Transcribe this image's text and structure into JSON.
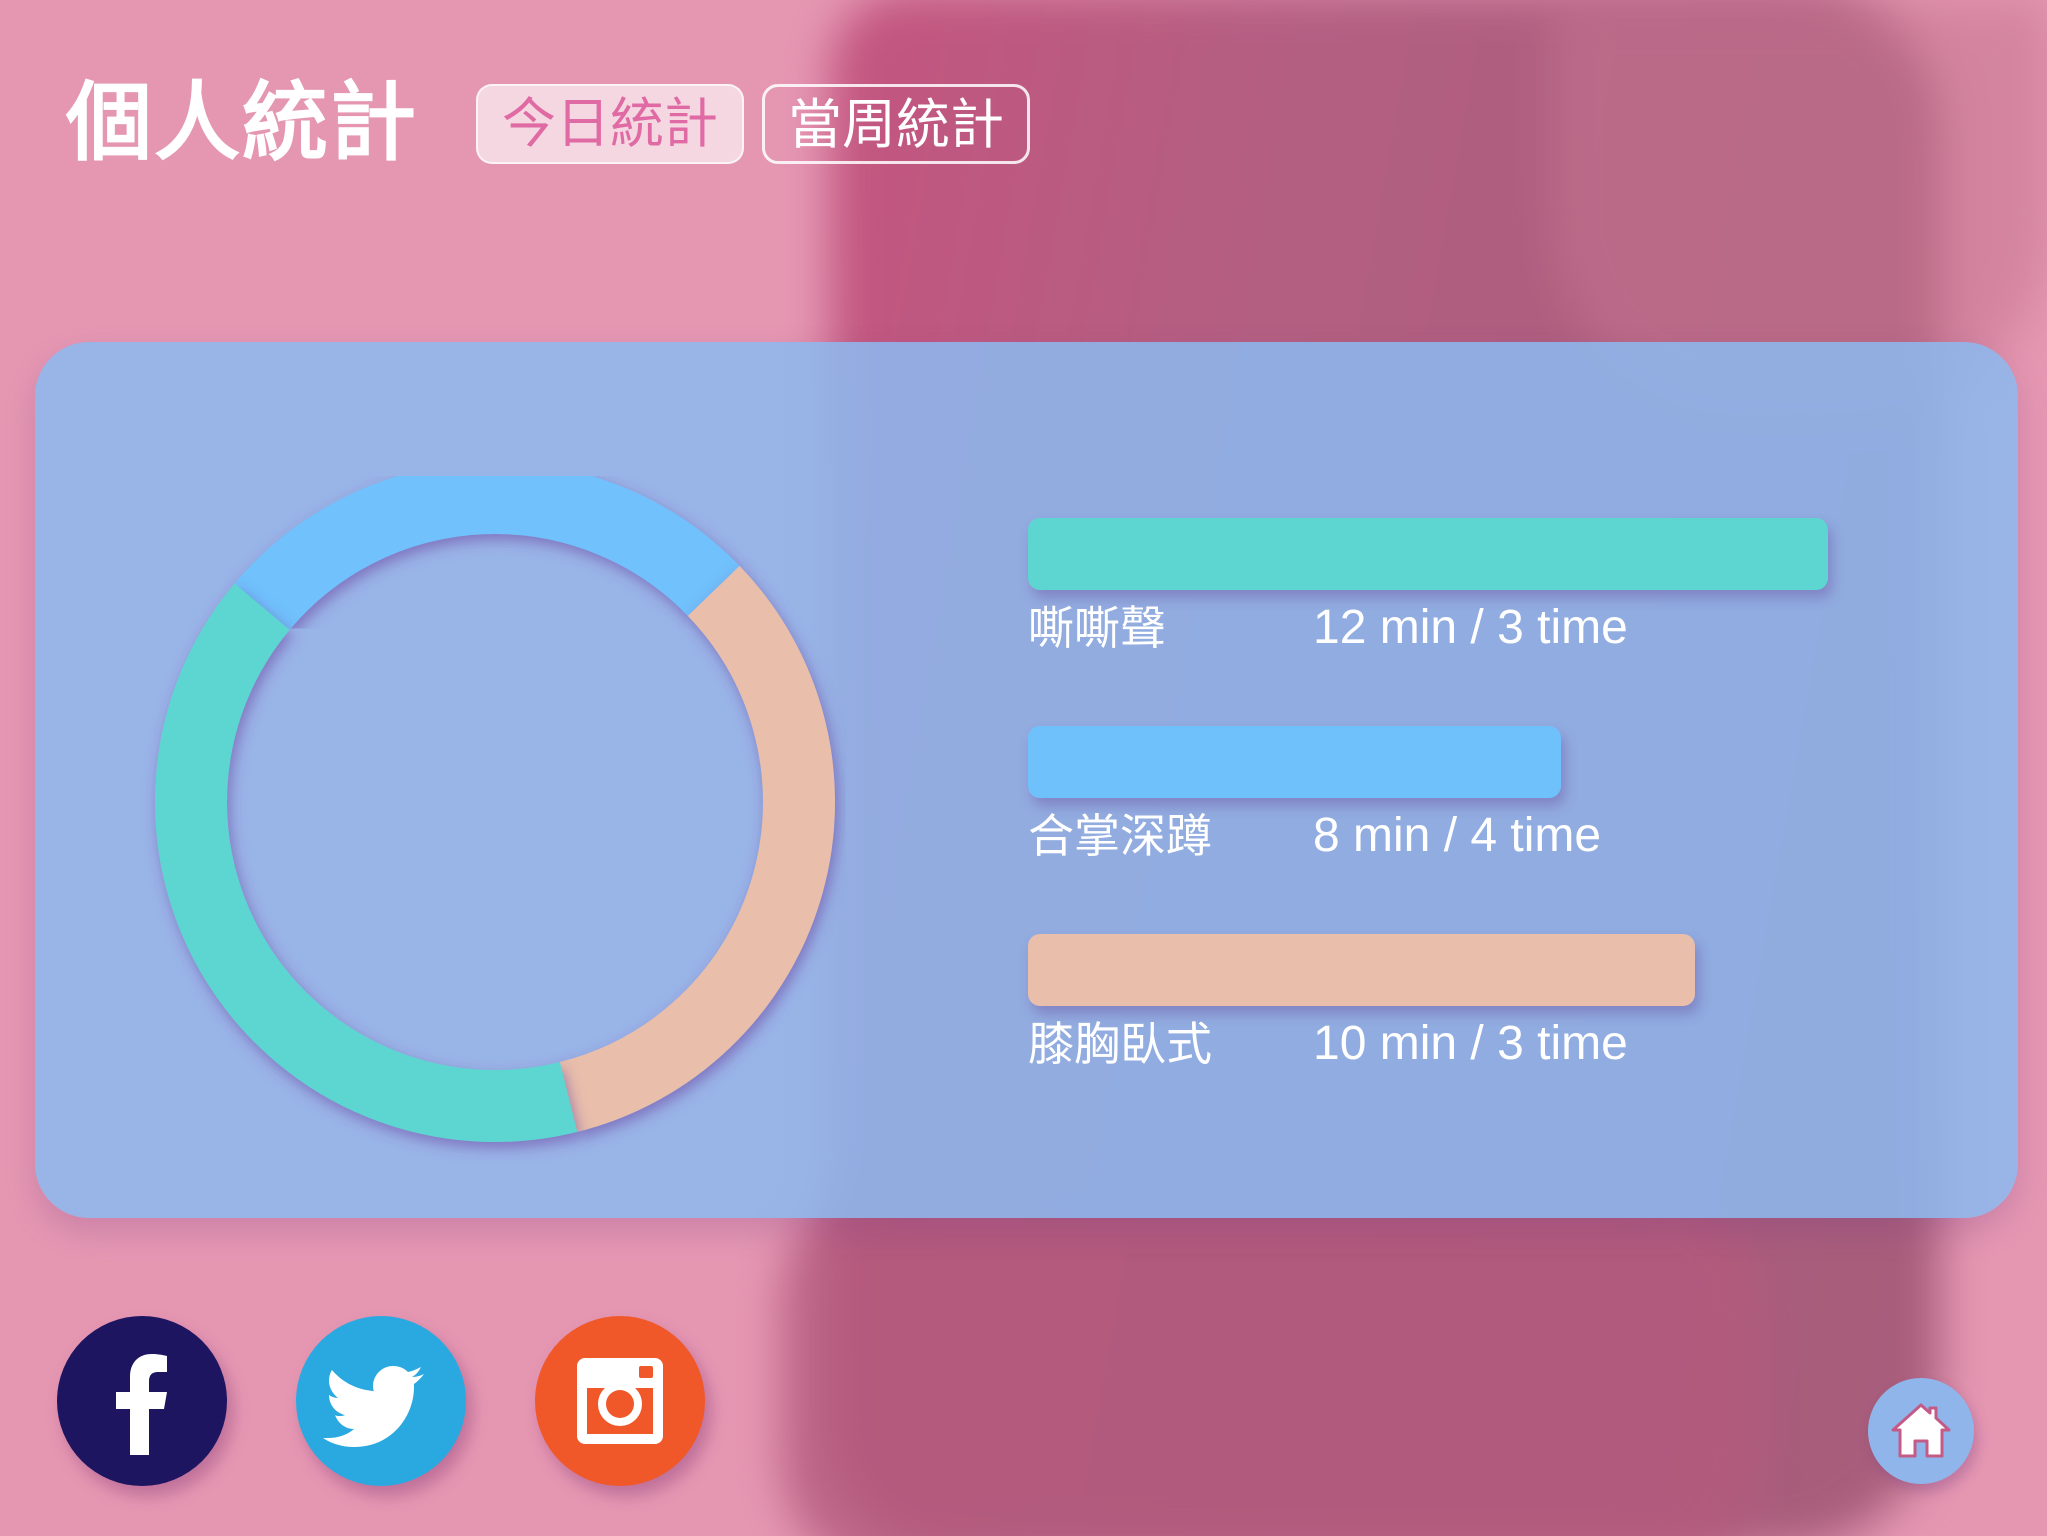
{
  "header": {
    "title": "個人統計",
    "tabs": [
      {
        "label": "今日統計",
        "active": true
      },
      {
        "label": "當周統計",
        "active": false
      }
    ]
  },
  "stats": {
    "items": [
      {
        "name": "嘶嘶聲",
        "value": "12 min / 3 time",
        "minutes": 12,
        "times": 3,
        "color": "#5dd6d2"
      },
      {
        "name": "合掌深蹲",
        "value": "8 min / 4 time",
        "minutes": 8,
        "times": 4,
        "color": "#6fc1fc"
      },
      {
        "name": "膝胸臥式",
        "value": "10 min / 3 time",
        "minutes": 10,
        "times": 3,
        "color": "#e9bfab"
      }
    ]
  },
  "social": {
    "icons": [
      "facebook-icon",
      "twitter-icon",
      "instagram-icon"
    ],
    "colors": {
      "facebook": "#1d1560",
      "twitter": "#2aa9e0",
      "instagram": "#f0582a"
    }
  },
  "nav": {
    "home_icon": "home-icon",
    "home_color": "#8fb5ea"
  },
  "theme": {
    "accent": "#e06aa3",
    "card": "#8cb9f0",
    "background": "#e597b2"
  }
}
